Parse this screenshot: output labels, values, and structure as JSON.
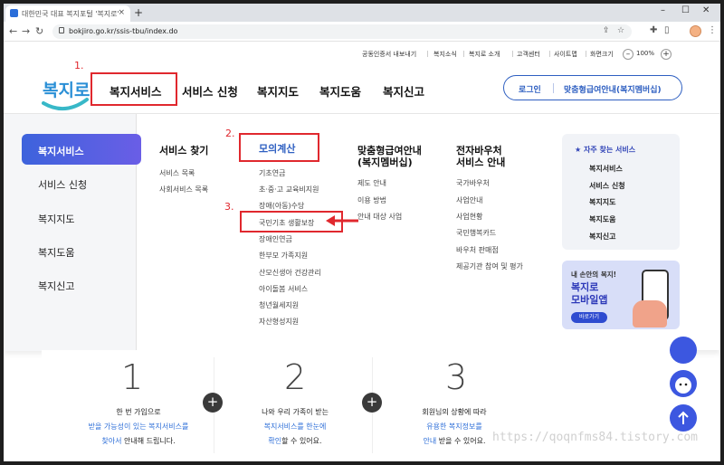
{
  "browser": {
    "tab_title": "대한민국 대표 복지포털 '복지로'",
    "tab_close": "×",
    "new_tab": "+",
    "url": "bokjiro.go.kr/ssis-tbu/index.do",
    "win_min": "–",
    "win_max": "☐",
    "win_close": "✕",
    "back": "←",
    "forward": "→",
    "reload": "↻"
  },
  "utility_links": [
    "공동인증서 내보내기",
    "복지소식",
    "복지로 소개",
    "고객센터",
    "사이트맵",
    "화면크기"
  ],
  "zoom": {
    "minus": "–",
    "plus": "+",
    "value": "100%"
  },
  "logo_text": "복지로",
  "gnb": [
    "복지서비스",
    "서비스 신청",
    "복지지도",
    "복지도움",
    "복지신고"
  ],
  "login": {
    "login_label": "로그인",
    "custom_label": "맞춤형급여안내(복지멤버십)"
  },
  "annotations": {
    "n1": "1.",
    "n2": "2.",
    "n3": "3."
  },
  "mega": {
    "left": [
      "복지서비스",
      "서비스 신청",
      "복지지도",
      "복지도움",
      "복지신고"
    ],
    "col1": {
      "title": "서비스 찾기",
      "items": [
        "서비스 목록",
        "사회서비스 목록"
      ]
    },
    "col2": {
      "title": "모의계산",
      "items": [
        "기초연금",
        "초·중·고 교육비지원",
        "장애(아동)수당",
        "국민기초 생활보장",
        "장애인연금",
        "한부모 가족지원",
        "산모신생아 건강관리",
        "아이돌봄 서비스",
        "청년월세지원",
        "자산형성지원"
      ]
    },
    "col3": {
      "title_l1": "맞춤형급여안내",
      "title_l2": "(복지멤버십)",
      "items": [
        "제도 안내",
        "이용 방법",
        "안내 대상 사업"
      ]
    },
    "col4": {
      "title_l1": "전자바우처",
      "title_l2": "서비스 안내",
      "items": [
        "국가바우처",
        "사업안내",
        "사업현황",
        "국민행복카드",
        "바우처 판매점",
        "제공기관 참여 및 평가"
      ]
    },
    "frequent": {
      "title": "자주 찾는 서비스",
      "items": [
        "복지서비스",
        "서비스 신청",
        "복지지도",
        "복지도움",
        "복지신고"
      ]
    },
    "promo": {
      "line1": "내 손안의 복지!",
      "line2": "복지로",
      "line3": "모바일앱",
      "button": "바로가기"
    }
  },
  "steps": [
    {
      "num": "1",
      "l1": "한 번 가입으로",
      "l2_hl": "받을 가능성이 있는 복지서비스를",
      "l3_hl": "찾아서",
      "l3_rest": " 안내해 드립니다."
    },
    {
      "num": "2",
      "l1": "나와 우리 가족이 받는",
      "l2_hl": "복지서비스를 한눈에",
      "l3_hl": "확인",
      "l3_rest": "할 수 있어요."
    },
    {
      "num": "3",
      "l1": "회원님의 상황에 따라",
      "l2_hl": "유용한 복지정보를",
      "l3_hl": "안내",
      "l3_rest": " 받을 수 있어요."
    }
  ],
  "plus_sign": "+",
  "watermark": "https://qoqnfms84.tistory.com",
  "colors": {
    "accent": "#2e5fc1",
    "annotation": "#e0282e",
    "active_gradient_start": "#3d63dc",
    "highlight": "#2e6fd8"
  }
}
